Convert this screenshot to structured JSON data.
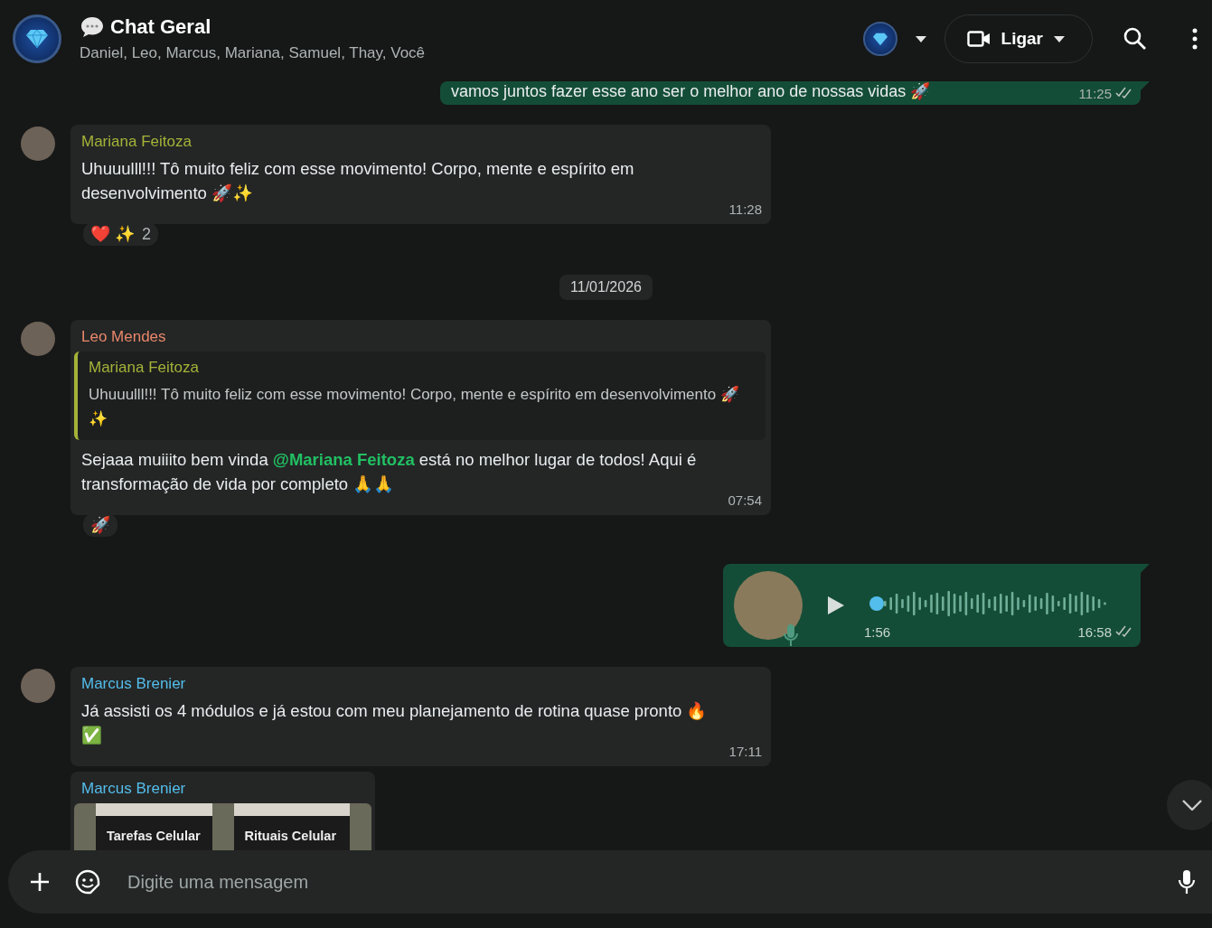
{
  "header": {
    "title": "Chat Geral",
    "members": "Daniel, Leo, Marcus, Mariana, Samuel, Thay, Você",
    "call_button": "Ligar"
  },
  "messages": [
    {
      "kind": "outgoing_text",
      "text": "vamos juntos fazer esse ano ser o melhor ano de nossas vidas 🚀",
      "time": "11:25"
    },
    {
      "kind": "incoming_text",
      "avatar": true,
      "sender": "Mariana Feitoza",
      "color": "#a5b337",
      "text": "Uhuuulll!!! Tô muito feliz com esse movimento! Corpo, mente e espírito em desenvolvimento 🚀✨",
      "time": "11:28",
      "reactions": "❤️ ✨",
      "reaction_count": "2"
    },
    {
      "kind": "date",
      "text": "11/01/2026"
    },
    {
      "kind": "incoming_text",
      "avatar": true,
      "sender": "Leo Mendes",
      "color": "#e9876a",
      "quote": {
        "sender": "Mariana Feitoza",
        "color": "#a5b337",
        "text": "Uhuuulll!!! Tô muito feliz com esse movimento! Corpo, mente e espírito em desenvolvimento 🚀✨"
      },
      "text": "Sejaaa muiiito bem vinda **@Mariana Feitoza** está no melhor lugar de todos! Aqui é transformação de vida por completo 🙏🙏",
      "time": "07:54",
      "reactions": "🚀"
    },
    {
      "kind": "outgoing_audio",
      "duration": "1:56",
      "time": "16:58",
      "level": 0
    },
    {
      "kind": "incoming_text",
      "avatar": true,
      "sender": "Marcus Brenier",
      "color": "#53bdeb",
      "text": "Já assisti os 4 módulos e já estou com meu planejamento de rotina quase pronto 🔥✅",
      "time": "17:11"
    },
    {
      "kind": "incoming_image",
      "avatar": false,
      "sender": "Marcus Brenier",
      "color": "#53bdeb",
      "captions": [
        "Tarefas Celular",
        "Rituais Celular"
      ]
    }
  ],
  "composer": {
    "placeholder": "Digite uma mensagem"
  }
}
